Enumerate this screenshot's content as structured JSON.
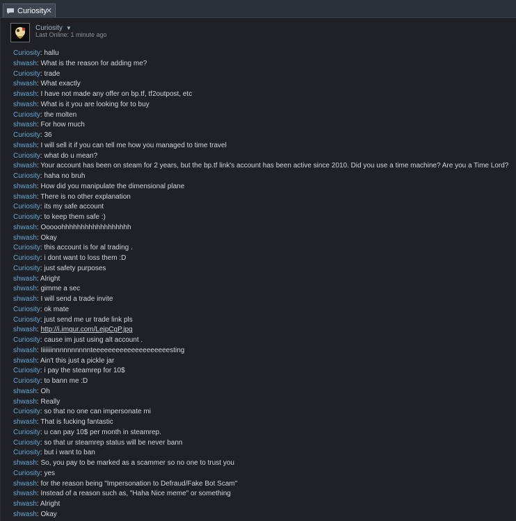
{
  "tab": {
    "title": "Curiosity",
    "close_label": "✕"
  },
  "header": {
    "name": "Curiosity",
    "status": "Last Online: 1 minute ago"
  },
  "messages": [
    {
      "author": "Curiosity",
      "text": "hallu"
    },
    {
      "author": "shwash",
      "text": "What is the reason for adding me?"
    },
    {
      "author": "Curiosity",
      "text": "trade"
    },
    {
      "author": "shwash",
      "text": "What exactly"
    },
    {
      "author": "shwash",
      "text": "I have not made any offer on bp.tf, tf2outpost, etc"
    },
    {
      "author": "shwash",
      "text": "What is it you are looking for to buy"
    },
    {
      "author": "Curiosity",
      "text": "the molten"
    },
    {
      "author": "shwash",
      "text": "For how much"
    },
    {
      "author": "Curiosity",
      "text": "36"
    },
    {
      "author": "shwash",
      "text": "I will sell it if you can tell me how you managed to time travel"
    },
    {
      "author": "Curiosity",
      "text": "what do u mean?"
    },
    {
      "author": "shwash",
      "text": "Your account has been on steam for 2 years, but the bp.tf link's account has been active since 2010. Did you use a time machine? Are you a Time Lord?"
    },
    {
      "author": "Curiosity",
      "text": "haha no bruh"
    },
    {
      "author": "shwash",
      "text": "How did you manipulate the dimensional plane"
    },
    {
      "author": "shwash",
      "text": "There is no other explanation"
    },
    {
      "author": "Curiosity",
      "text": "its my safe account"
    },
    {
      "author": "Curiosity",
      "text": "to keep them safe :)"
    },
    {
      "author": "shwash",
      "text": "Ooooohhhhhhhhhhhhhhhhhh"
    },
    {
      "author": "shwash",
      "text": "Okay"
    },
    {
      "author": "Curiosity",
      "text": "this account is for al trading ."
    },
    {
      "author": "Curiosity",
      "text": "i dont want to loss them :D"
    },
    {
      "author": "Curiosity",
      "text": "just safety purposes"
    },
    {
      "author": "shwash",
      "text": "Alright"
    },
    {
      "author": "shwash",
      "text": "gimme a sec"
    },
    {
      "author": "shwash",
      "text": "I will send a trade invite"
    },
    {
      "author": "Curiosity",
      "text": "ok mate"
    },
    {
      "author": "Curiosity",
      "text": "just send me ur trade link pls"
    },
    {
      "author": "shwash",
      "text": "http://i.imgur.com/LejpCgP.jpg",
      "link": true
    },
    {
      "author": "Curiosity",
      "text": "cause im just using alt account ."
    },
    {
      "author": "shwash",
      "text": "Iiiiiiinnnnnnnnnnteeeeeeeeeeeeeeeeeeeesting"
    },
    {
      "author": "shwash",
      "text": "Ain't this just a pickle jar"
    },
    {
      "author": "Curiosity",
      "text": "i pay the steamrep for 10$"
    },
    {
      "author": "Curiosity",
      "text": "to bann me :D"
    },
    {
      "author": "shwash",
      "text": "Oh"
    },
    {
      "author": "shwash",
      "text": "Really"
    },
    {
      "author": "Curiosity",
      "text": "so that no one can impersonate mi"
    },
    {
      "author": "shwash",
      "text": "That is fucking fantastic"
    },
    {
      "author": "Curiosity",
      "text": "u can pay 10$ per month in steamrep."
    },
    {
      "author": "Curiosity",
      "text": "so that ur steamrep status will be never bann"
    },
    {
      "author": "Curiosity",
      "text": "but i want to ban"
    },
    {
      "author": "shwash",
      "text": "So, you pay to be marked as a scammer so no one to trust you"
    },
    {
      "author": "Curiosity",
      "text": "yes"
    },
    {
      "author": "shwash",
      "text": "for the reason being \"Impersonation to Defraud/Fake Bot Scam\""
    },
    {
      "author": "shwash",
      "text": "Instead of a reason such as, \"Haha Nice meme\" or something"
    },
    {
      "author": "shwash",
      "text": "Alright"
    },
    {
      "author": "shwash",
      "text": "Okay"
    }
  ]
}
